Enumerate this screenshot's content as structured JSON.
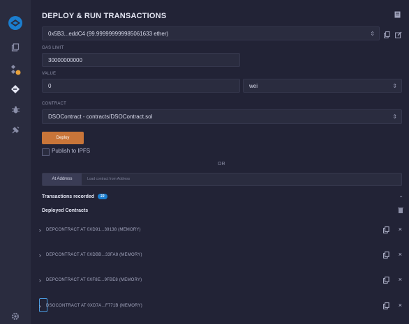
{
  "panel": {
    "title": "DEPLOY & RUN TRANSACTIONS"
  },
  "account": {
    "value": "0x5B3...eddC4 (99.999999999985061633 ether)"
  },
  "gas": {
    "label": "GAS LIMIT",
    "value": "30000000000"
  },
  "value": {
    "label": "VALUE",
    "amount": "0",
    "unit": "wei"
  },
  "contract": {
    "label": "CONTRACT",
    "selected": "DSOContract - contracts/DSOContract.sol"
  },
  "deploy": {
    "label": "Deploy",
    "publish_label": "Publish to IPFS"
  },
  "or_label": "OR",
  "at_address": {
    "button_label": "At Address",
    "placeholder": "Load contract from Address"
  },
  "transactions": {
    "label": "Transactions recorded",
    "count": "22"
  },
  "deployed": {
    "label": "Deployed Contracts",
    "items": [
      "DEPCONTRACT AT 0XD91...39138 (MEMORY)",
      "DEPCONTRACT AT 0XDBB...33FA8 (MEMORY)",
      "DEPCONTRACT AT 0XF8E...9FBE8 (MEMORY)",
      "DSOCONTRACT AT 0XD7A...F771B (MEMORY)"
    ]
  }
}
